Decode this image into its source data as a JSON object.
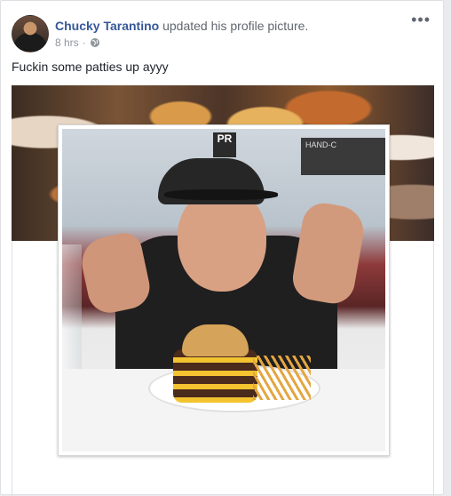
{
  "post": {
    "author": "Chucky Tarantino",
    "action": "updated his profile picture.",
    "time": "8 hrs",
    "separator": "·",
    "privacy_icon": "globe-icon",
    "more_label": "•••",
    "text": "Fuckin some patties up ayyy"
  },
  "photo": {
    "sign_text": "PR",
    "menu_text": "HAND-C"
  },
  "colors": {
    "author_link": "#365899",
    "meta_text": "#90949c",
    "background": "#e9ebee"
  }
}
